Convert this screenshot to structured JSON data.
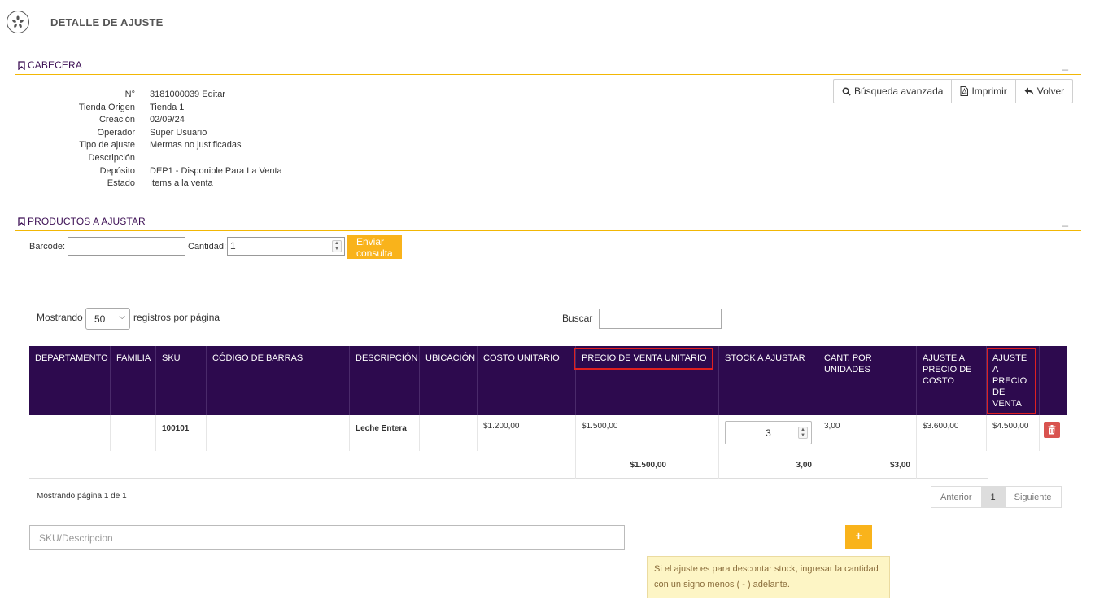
{
  "header": {
    "title": "DETALLE DE AJUSTE",
    "logo_icon": "starburst-logo-icon"
  },
  "cabecera": {
    "section_title": "CABECERA",
    "collapse": "_",
    "fields": [
      {
        "key": "N°",
        "value": "3181000039 Editar"
      },
      {
        "key": "Tienda Origen",
        "value": "Tienda 1"
      },
      {
        "key": "Creación",
        "value": "02/09/24"
      },
      {
        "key": "Operador",
        "value": "Super Usuario"
      },
      {
        "key": "Tipo de ajuste",
        "value": "Mermas no justificadas"
      },
      {
        "key": "Descripción",
        "value": ""
      },
      {
        "key": "Depósito",
        "value": "DEP1 - Disponible Para La Venta"
      },
      {
        "key": "Estado",
        "value": "Items a la venta"
      }
    ]
  },
  "actions": {
    "search_advanced": "Búsqueda avanzada",
    "print": "Imprimir",
    "back": "Volver"
  },
  "productos": {
    "section_title": "PRODUCTOS A AJUSTAR",
    "collapse": "_",
    "barcode_label": "Barcode:",
    "barcode_value": "",
    "quantity_label": "Cantidad:",
    "quantity_value": "1",
    "submit_label": "Enviar consulta"
  },
  "table": {
    "length_prefix": "Mostrando",
    "length_value": "50",
    "length_suffix": "registros por página",
    "search_label": "Buscar",
    "columns": [
      "DEPARTAMENTO",
      "FAMILIA",
      "SKU",
      "CÓDIGO DE BARRAS",
      "DESCRIPCIÓN",
      "UBICACIÓN",
      "COSTO UNITARIO",
      "PRECIO DE VENTA UNITARIO",
      "STOCK A AJUSTAR",
      "CANT. POR UNIDADES",
      "AJUSTE A PRECIO DE COSTO",
      "AJUSTE A PRECIO DE VENTA"
    ],
    "rows": [
      {
        "departamento": "",
        "familia": "",
        "sku": "100101",
        "codigo_barras": "",
        "descripcion": "Leche Entera",
        "ubicacion": "",
        "costo_unitario": "$1.200,00",
        "precio_venta_unitario": "$1.500,00",
        "stock_ajustar": "3",
        "cant_unidades": "3,00",
        "ajuste_costo": "$3.600,00",
        "ajuste_venta": "$4.500,00"
      }
    ],
    "totals": {
      "precio_venta": "$1.500,00",
      "stock": "3,00",
      "cant": "$3,00"
    },
    "info": "Mostrando página 1 de 1",
    "pager": {
      "prev": "Anterior",
      "current": "1",
      "next": "Siguiente"
    }
  },
  "add": {
    "sku_placeholder": "SKU/Descripcion",
    "plus_label": "+",
    "hint": "Si el ajuste es para descontar stock, ingresar la cantidad con un signo menos ( - ) adelante."
  },
  "colors": {
    "header_bg": "#2d0a4e",
    "accent": "#f9b31b",
    "section_text": "#3c0f54",
    "highlight": "#e02020",
    "danger": "#d9534f"
  }
}
